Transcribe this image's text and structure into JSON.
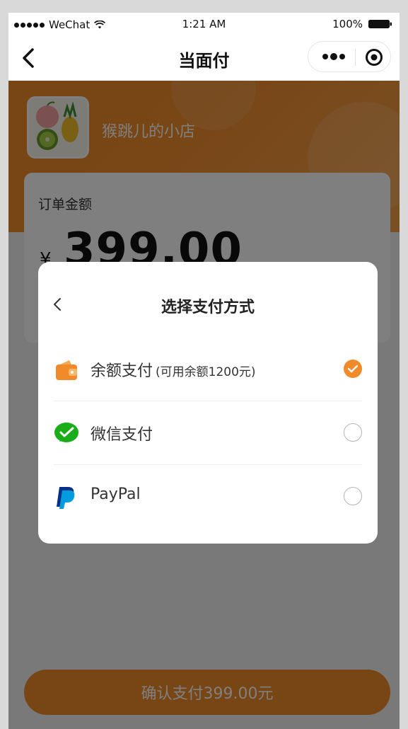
{
  "status_bar": {
    "carrier": "WeChat",
    "time": "1:21 AM",
    "battery": "100%"
  },
  "nav": {
    "title": "当面付",
    "back_icon": "chevron-left-icon",
    "more_icon": "more-dots-icon",
    "close_icon": "target-circle-icon"
  },
  "shop": {
    "name": "猴跳儿的小店",
    "logo_icon": "fruit-logo"
  },
  "order": {
    "amount_label": "订单金额",
    "currency": "¥",
    "amount": "399.00"
  },
  "payment_sheet": {
    "title": "选择支付方式",
    "options": [
      {
        "label": "余额支付",
        "note": "(可用余额1200元)",
        "icon": "wallet-icon",
        "selected": true
      },
      {
        "label": "微信支付",
        "note": "",
        "icon": "wechat-pay-icon",
        "selected": false
      },
      {
        "label": "PayPal",
        "note": "",
        "icon": "paypal-icon",
        "selected": false
      }
    ]
  },
  "confirm_button": {
    "label": "确认支付399.00元"
  },
  "colors": {
    "accent": "#f08a2a",
    "wechat_green": "#1aad19",
    "paypal_blue": "#009cde"
  }
}
